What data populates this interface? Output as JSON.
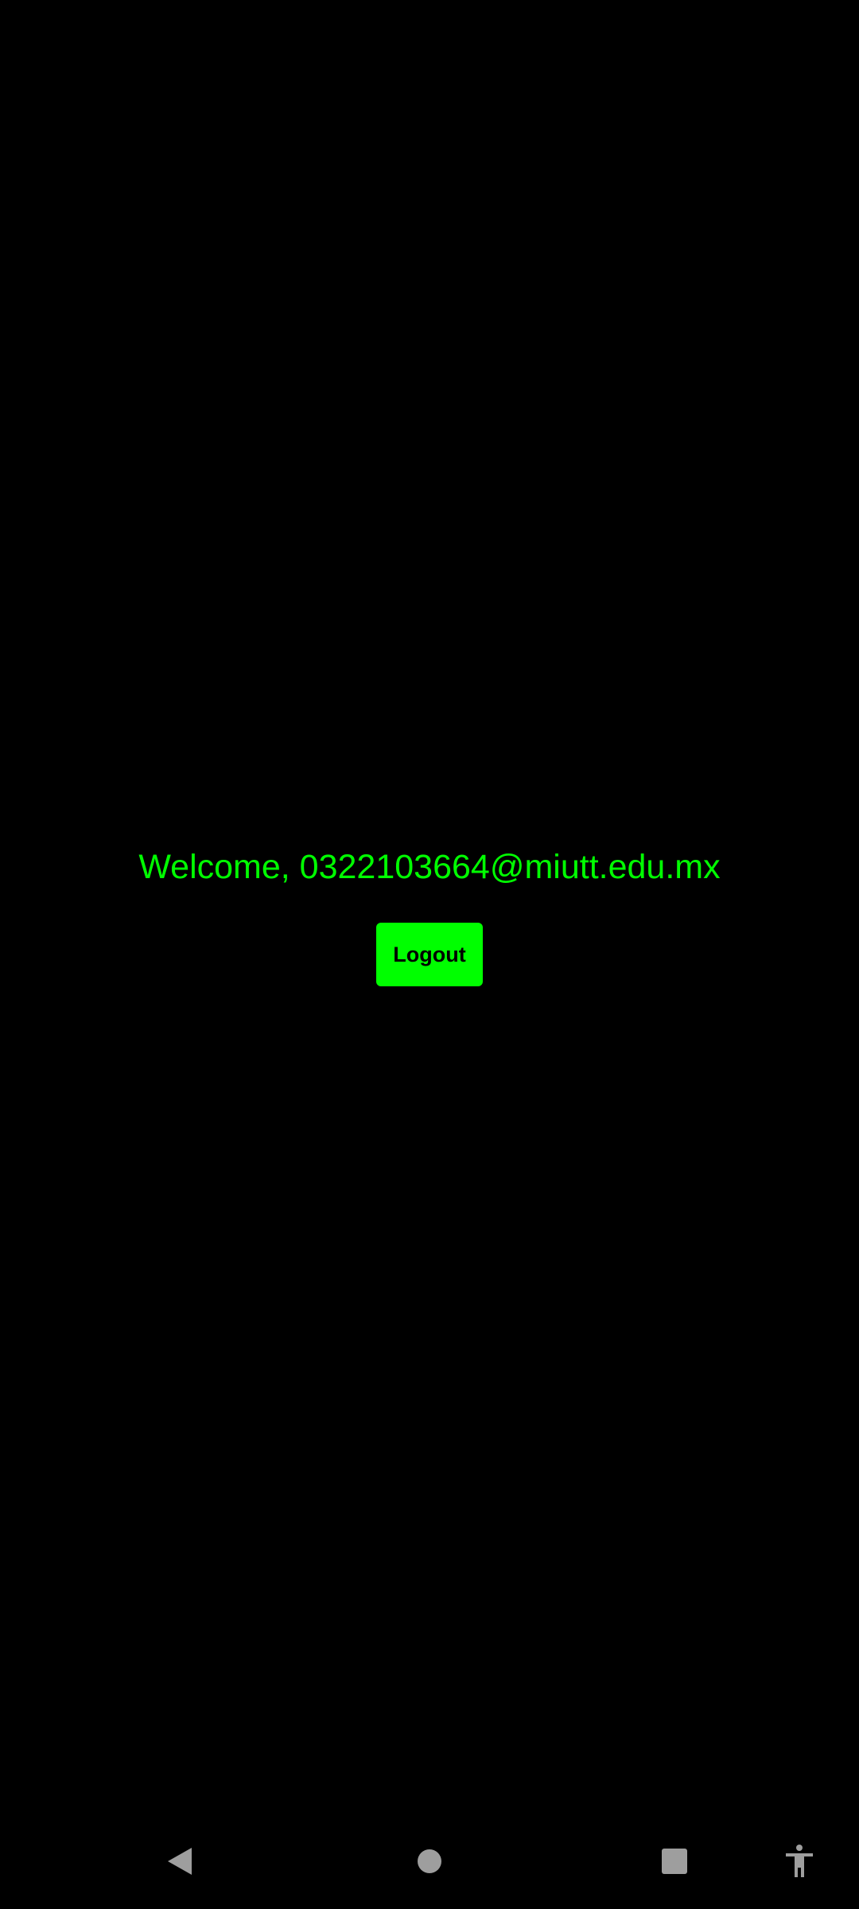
{
  "main": {
    "welcome_text": "Welcome, 0322103664@miutt.edu.mx",
    "logout_label": "Logout"
  },
  "colors": {
    "background": "#000000",
    "accent": "#00ff00",
    "nav_icon": "#9e9e9e"
  },
  "navbar": {
    "icons": [
      "back-icon",
      "home-icon",
      "recents-icon",
      "accessibility-icon"
    ]
  }
}
